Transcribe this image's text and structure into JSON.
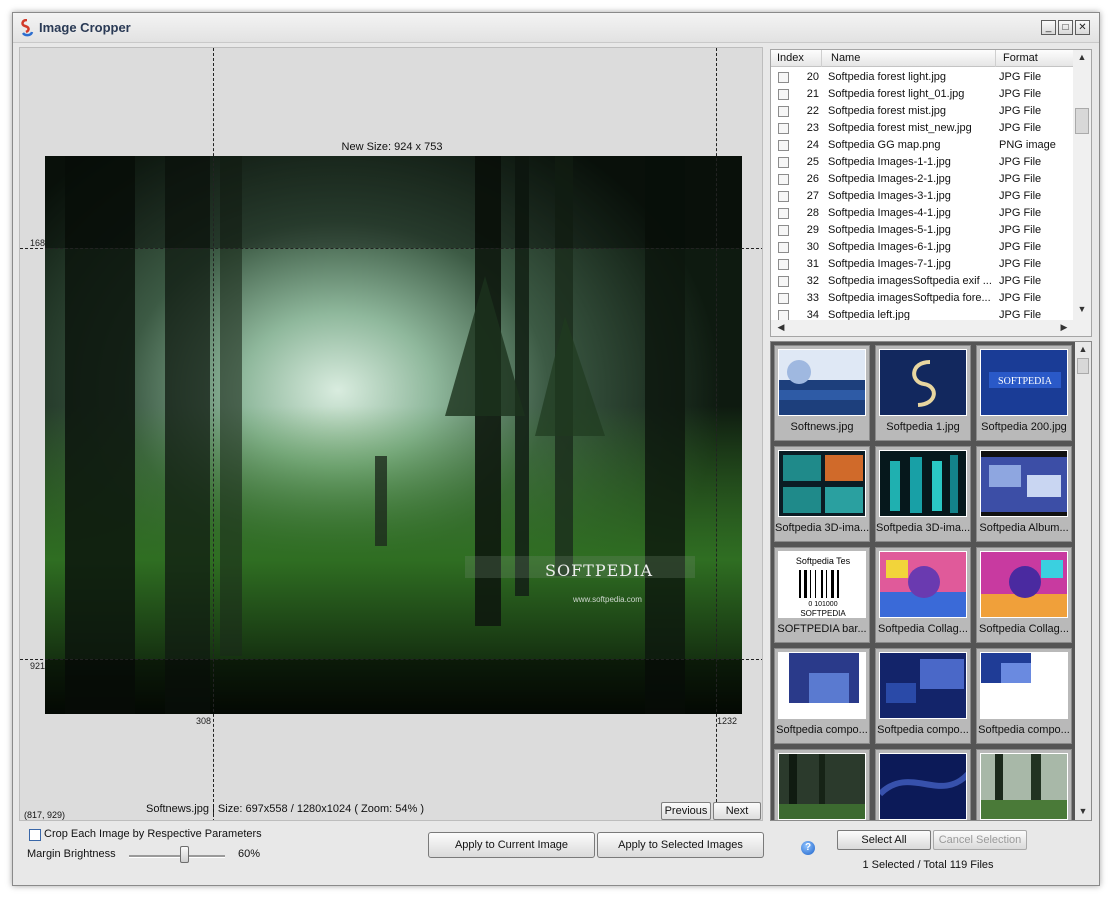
{
  "window": {
    "title": "Image Cropper",
    "minimize": "_",
    "maximize": "□",
    "close": "✕"
  },
  "preview": {
    "new_size": "New Size: 924 x 753",
    "rulers": {
      "top_left": "168",
      "bottom_left": "921",
      "left_bottom": "308",
      "right_bottom": "1232"
    },
    "coords": "(817, 929)",
    "status": "Softnews.jpg  |  Size: 697x558 / 1280x1024 ( Zoom: 54% )",
    "previous": "Previous",
    "next": "Next",
    "watermark": "SOFTPEDIA",
    "watermark_url": "www.softpedia.com"
  },
  "file_list": {
    "columns": [
      "Index",
      "Name",
      "Format"
    ],
    "rows": [
      {
        "index": "20",
        "name": "Softpedia forest light.jpg",
        "format": "JPG File"
      },
      {
        "index": "21",
        "name": "Softpedia forest light_01.jpg",
        "format": "JPG File"
      },
      {
        "index": "22",
        "name": "Softpedia forest mist.jpg",
        "format": "JPG File"
      },
      {
        "index": "23",
        "name": "Softpedia forest mist_new.jpg",
        "format": "JPG File"
      },
      {
        "index": "24",
        "name": "Softpedia GG map.png",
        "format": "PNG image"
      },
      {
        "index": "25",
        "name": "Softpedia Images-1-1.jpg",
        "format": "JPG File"
      },
      {
        "index": "26",
        "name": "Softpedia Images-2-1.jpg",
        "format": "JPG File"
      },
      {
        "index": "27",
        "name": "Softpedia Images-3-1.jpg",
        "format": "JPG File"
      },
      {
        "index": "28",
        "name": "Softpedia Images-4-1.jpg",
        "format": "JPG File"
      },
      {
        "index": "29",
        "name": "Softpedia Images-5-1.jpg",
        "format": "JPG File"
      },
      {
        "index": "30",
        "name": "Softpedia Images-6-1.jpg",
        "format": "JPG File"
      },
      {
        "index": "31",
        "name": "Softpedia Images-7-1.jpg",
        "format": "JPG File"
      },
      {
        "index": "32",
        "name": "Softpedia imagesSoftpedia exif ...",
        "format": "JPG File"
      },
      {
        "index": "33",
        "name": "Softpedia imagesSoftpedia fore...",
        "format": "JPG File"
      },
      {
        "index": "34",
        "name": "Softpedia left.jpg",
        "format": "JPG File"
      }
    ]
  },
  "thumbnails": [
    {
      "caption": "Softnews.jpg",
      "style": "news"
    },
    {
      "caption": "Softpedia 1.jpg",
      "style": "blue-s"
    },
    {
      "caption": "Softpedia 200.jpg",
      "style": "blue-softpedia"
    },
    {
      "caption": "Softpedia 3D-ima...",
      "style": "teal-grid"
    },
    {
      "caption": "Softpedia 3D-ima...",
      "style": "teal-bars"
    },
    {
      "caption": "Softpedia Album...",
      "style": "film"
    },
    {
      "caption": "SOFTPEDIA bar...",
      "style": "barcode"
    },
    {
      "caption": "Softpedia Collag...",
      "style": "collage"
    },
    {
      "caption": "Softpedia Collag...",
      "style": "collage2"
    },
    {
      "caption": "Softpedia compo...",
      "style": "compo1"
    },
    {
      "caption": "Softpedia compo...",
      "style": "compo2"
    },
    {
      "caption": "Softpedia compo...",
      "style": "compo3"
    },
    {
      "caption": "",
      "style": "forest1"
    },
    {
      "caption": "",
      "style": "dark-blue"
    },
    {
      "caption": "",
      "style": "forest2"
    }
  ],
  "barcode": {
    "title": "Softpedia Tes",
    "digits": "0 101000",
    "brand": "SOFTPEDIA"
  },
  "controls": {
    "crop_each": "Crop Each Image by Respective Parameters",
    "margin_label": "Margin Brightness",
    "margin_value": "60%",
    "margin_level": 0.6,
    "apply_current": "Apply to Current Image",
    "apply_selected": "Apply to Selected Images",
    "help": "?",
    "select_all": "Select All",
    "cancel_selection": "Cancel Selection",
    "selection_status": "1 Selected / Total 119 Files"
  }
}
